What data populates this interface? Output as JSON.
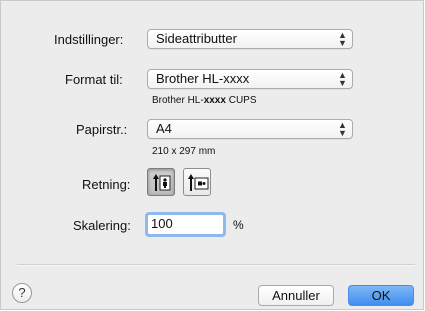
{
  "settings": {
    "label": "Indstillinger:",
    "value": "Sideattributter"
  },
  "format": {
    "label": "Format til:",
    "value": "Brother HL-xxxx",
    "sub_prefix": "Brother HL-",
    "sub_bold": "xxxx",
    "sub_suffix": " CUPS"
  },
  "paper": {
    "label": "Papirstr.:",
    "value": "A4",
    "dimensions": "210 x 297 mm"
  },
  "orientation": {
    "label": "Retning:",
    "selected": "portrait",
    "portrait_icon": "portrait-orientation-icon",
    "landscape_icon": "landscape-orientation-icon"
  },
  "scale": {
    "label": "Skalering:",
    "value": "100",
    "unit": "%"
  },
  "buttons": {
    "help": "?",
    "cancel": "Annuller",
    "ok": "OK"
  },
  "popup_arrows": {
    "up": "▲",
    "down": "▼"
  },
  "colors": {
    "accent": "#3f8ff0",
    "focus_ring": "#8db9f0",
    "dialog_bg": "#ececec"
  }
}
